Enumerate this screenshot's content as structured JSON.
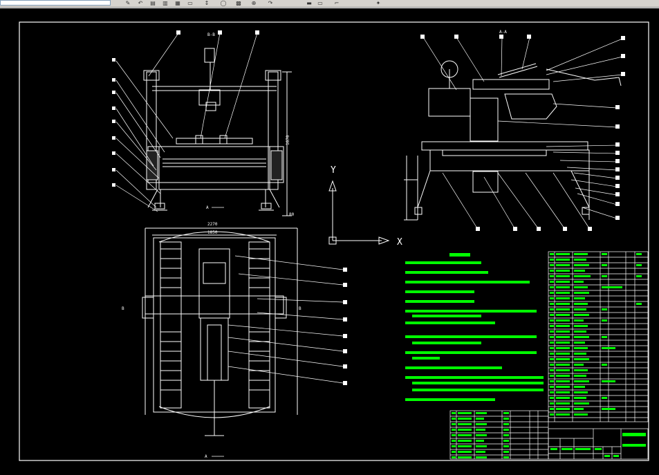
{
  "toolbar": {
    "icons": [
      "pen-icon",
      "undo-icon",
      "copy-icon",
      "paste-icon",
      "cursor-icon",
      "circle-icon",
      "grid-icon",
      "zoom-icon",
      "redo-icon",
      "window-icon",
      "rect-icon",
      "line-icon",
      "arrow-icon",
      "tool-icon"
    ]
  },
  "drawing": {
    "section_bb": "B-B",
    "section_aa": "A-A",
    "label_A_left": "A",
    "label_A_bottom": "A",
    "label_B_left": "B",
    "label_B_right": "B",
    "dim_width_top": "2270",
    "dim_width_inner": "1850",
    "dim_height_right": "1670",
    "dim_base": "80",
    "ucs_x": "X",
    "ucs_y": "Y"
  },
  "colors": {
    "background": "#000000",
    "lines": "#ffffff",
    "notes": "#00ff00",
    "table": "#ffffff"
  }
}
